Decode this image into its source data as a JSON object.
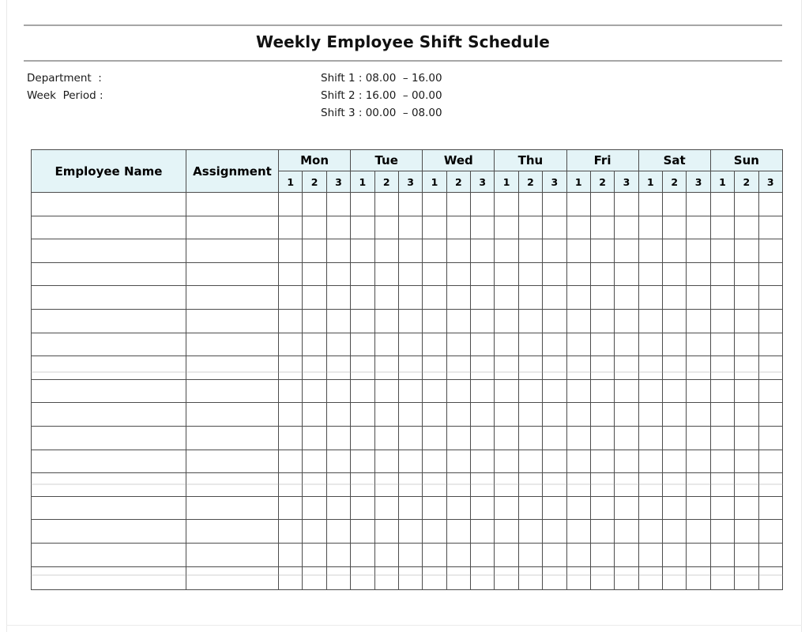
{
  "document": {
    "title": "Weekly Employee Shift Schedule"
  },
  "meta": {
    "fields": [
      {
        "label": "Department  :",
        "value": ""
      },
      {
        "label": "Week  Period :",
        "value": ""
      }
    ],
    "shift_legend": [
      "Shift 1 : 08.00  – 16.00",
      "Shift 2 : 16.00  – 00.00",
      "Shift 3 : 00.00  – 08.00"
    ]
  },
  "table": {
    "headers": {
      "employee_name": "Employee Name",
      "assignment": "Assignment"
    },
    "days": [
      "Mon",
      "Tue",
      "Wed",
      "Thu",
      "Fri",
      "Sat",
      "Sun"
    ],
    "shifts": [
      "1",
      "2",
      "3"
    ],
    "body_rows": 17,
    "row_values": []
  },
  "colors": {
    "header_fill": "#e4f4f7",
    "grid_line": "#4d4d4d",
    "rule": "#a6a6a6",
    "text": "#000000",
    "page_background": "#ffffff"
  }
}
